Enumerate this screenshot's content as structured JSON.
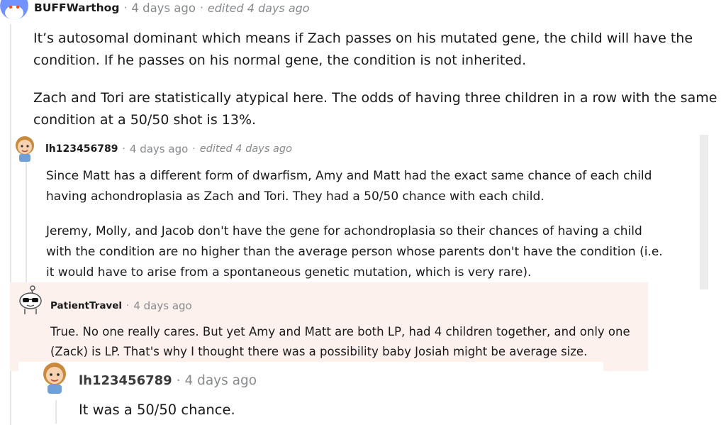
{
  "comments": [
    {
      "author": "BUFFWarthog",
      "sep1": "·",
      "time": "4 days ago",
      "sep2": "·",
      "edited": "edited 4 days ago",
      "paragraphs": [
        "It’s autosomal dominant which means if Zach passes on his mutated gene, the child will have the condition. If he passes on his normal gene, the condition is not inherited.",
        "Zach and Tori are statistically atypical here. The odds of having three children in a row with the same condition at a 50/50 shot is 13%."
      ]
    },
    {
      "author": "lh123456789",
      "sep1": "·",
      "time": "4 days ago",
      "sep2": "·",
      "edited": "edited 4 days ago",
      "paragraphs": [
        "Since Matt has a different form of dwarfism, Amy and Matt had the exact same chance of each child having achondroplasia as Zach and Tori. They had a 50/50 chance with each child.",
        "Jeremy, Molly, and Jacob don't have the gene for achondroplasia so their chances of having a child with the condition are no higher than the average person whose parents don't have the condition (i.e. it would have to arise from a spontaneous genetic mutation, which is very rare)."
      ]
    },
    {
      "author": "PatientTravel",
      "sep1": "·",
      "time": "4 days ago",
      "paragraphs": [
        "True. No one really cares. But yet Amy and Matt are both LP, had 4 children together, and only one (Zack) is LP. That's why I thought there was a possibility baby Josiah might be average size."
      ]
    },
    {
      "author": "lh123456789",
      "sep1": "·",
      "time": "4 days ago",
      "paragraphs": [
        "It was a 50/50 chance."
      ]
    }
  ],
  "colors": {
    "meta": "#878a8c",
    "highlight": "#fdf1ee",
    "thread_line": "#e4e6e8"
  },
  "icons": [
    "snoo-avatar-icon",
    "cartoon-avatar-icon",
    "sunglasses-snoo-avatar-icon"
  ]
}
